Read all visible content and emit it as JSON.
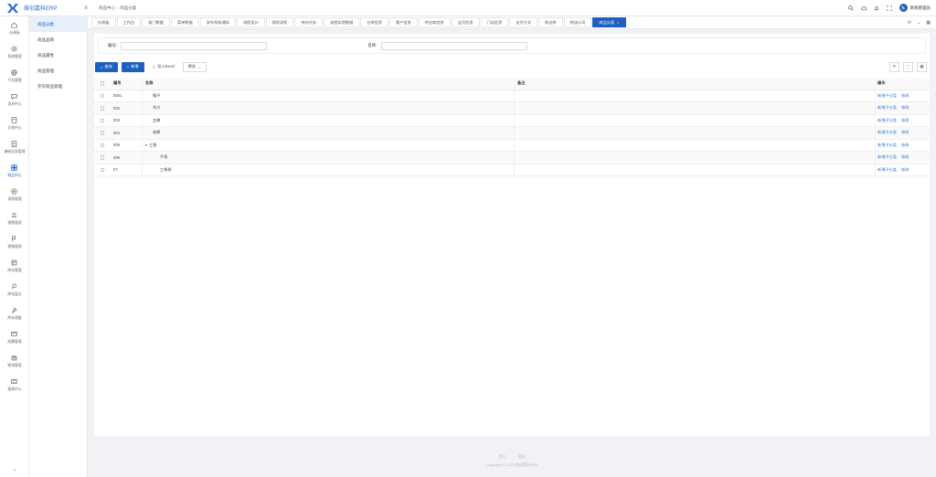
{
  "app": {
    "title": "维创嘉科ERP"
  },
  "breadcrumb": [
    "商品中心",
    "商品分类"
  ],
  "user": {
    "name": "系统管理员",
    "avatar_text": "系"
  },
  "left_nav": [
    {
      "label": "仪表板",
      "icon": "home-icon"
    },
    {
      "label": "系统管理",
      "icon": "gear-icon"
    },
    {
      "label": "平台管理",
      "icon": "globe-icon"
    },
    {
      "label": "消息中心",
      "icon": "message-icon"
    },
    {
      "label": "文档中心",
      "icon": "document-icon"
    },
    {
      "label": "基础业务管理",
      "icon": "table-icon"
    },
    {
      "label": "商品中心",
      "icon": "grid-icon",
      "active": true
    },
    {
      "label": "采购管理",
      "icon": "cart-icon"
    },
    {
      "label": "销售管理",
      "icon": "bell-icon"
    },
    {
      "label": "零售管理",
      "icon": "flag-icon"
    },
    {
      "label": "库存管理",
      "icon": "box-icon"
    },
    {
      "label": "库存盘点",
      "icon": "search-icon"
    },
    {
      "label": "库存调整",
      "icon": "wrench-icon"
    },
    {
      "label": "结算管理",
      "icon": "card-icon"
    },
    {
      "label": "物流管理",
      "icon": "truck-icon"
    },
    {
      "label": "报表中心",
      "icon": "report-icon"
    }
  ],
  "submenu": [
    {
      "label": "商品分类",
      "active": true
    },
    {
      "label": "商品品牌"
    },
    {
      "label": "商品属性"
    },
    {
      "label": "商品管理"
    },
    {
      "label": "存货商品管理"
    }
  ],
  "tabs": [
    {
      "label": "仪表板"
    },
    {
      "label": "工作台"
    },
    {
      "label": "部门数据"
    },
    {
      "label": "菜单数据"
    },
    {
      "label": "发布系统通知"
    },
    {
      "label": "流程设计"
    },
    {
      "label": "我的流程"
    },
    {
      "label": "待办任务"
    },
    {
      "label": "流程实例数据"
    },
    {
      "label": "仓库信息"
    },
    {
      "label": "客户信息"
    },
    {
      "label": "供应商信息"
    },
    {
      "label": "会员信息"
    },
    {
      "label": "门店信息"
    },
    {
      "label": "支付方式"
    },
    {
      "label": "地址库"
    },
    {
      "label": "物流公司"
    },
    {
      "label": "商品分类",
      "active": true
    }
  ],
  "filter": {
    "code_label": "编号:",
    "code_value": "",
    "name_label": "名称:",
    "name_value": ""
  },
  "toolbar": {
    "query": "查询",
    "add": "新增",
    "import": "导入Excel",
    "more": "更多"
  },
  "table": {
    "columns": {
      "code": "编号",
      "name": "名称",
      "remark": "备注",
      "op": "操作"
    },
    "op_labels": {
      "add_child": "新增子分类",
      "edit": "修改"
    },
    "rows": [
      {
        "code": "0001",
        "name": "帽子",
        "remark": "",
        "level": 1
      },
      {
        "code": "002",
        "name": "鸡爪",
        "remark": "",
        "level": 1
      },
      {
        "code": "003",
        "name": "五粮",
        "remark": "",
        "level": 1
      },
      {
        "code": "004",
        "name": "香蕉",
        "remark": "",
        "level": 1
      },
      {
        "code": "005",
        "name": "三角",
        "remark": "",
        "level": 0,
        "expanded": true
      },
      {
        "code": "006",
        "name": "手表",
        "remark": "",
        "level": 2
      },
      {
        "code": "07",
        "name": "三角裤",
        "remark": "",
        "level": 2
      }
    ]
  },
  "footer": {
    "links": [
      "首页",
      "帮助"
    ],
    "copyright": "Copyright © 2023 维创嘉科ERP"
  },
  "colors": {
    "primary": "#1f5fbf",
    "link": "#2f7ad8",
    "background": "#f0f2f5"
  }
}
